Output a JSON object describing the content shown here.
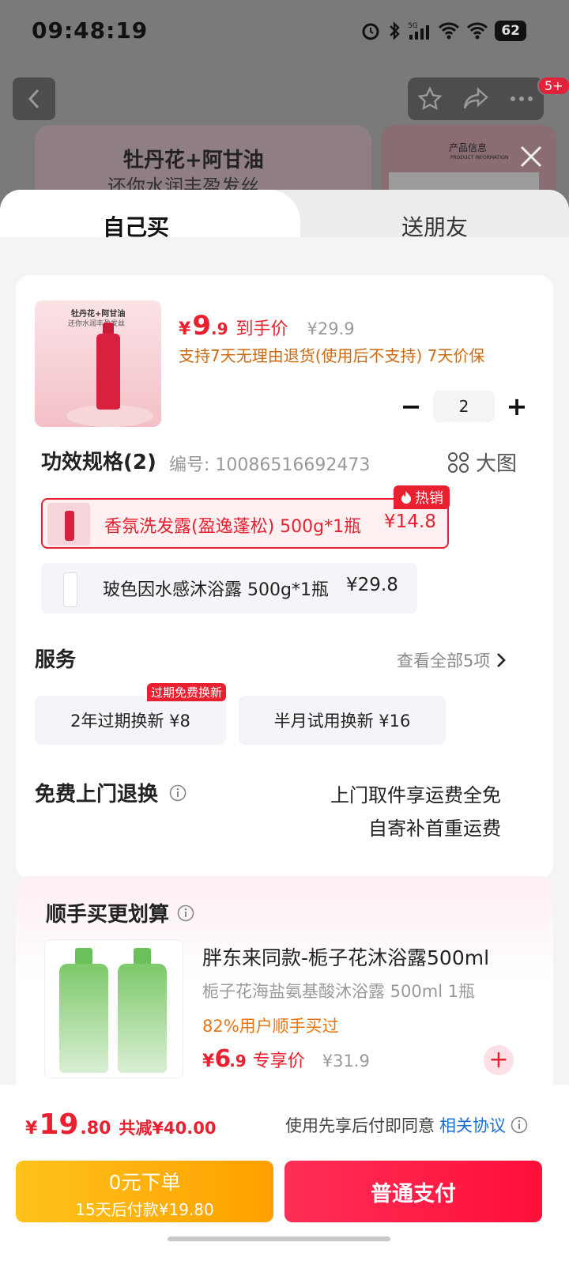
{
  "status_bar": {
    "time": "09:48:19",
    "battery": "62",
    "signal_label": "5G"
  },
  "background": {
    "badge": "5+",
    "card_title": "牡丹花+阿甘油",
    "card_subtitle": "还你水润丰盈发丝",
    "card2_title": "产品信息",
    "card2_subtitle": "PRODUCT INFORMATION"
  },
  "tabs": {
    "self": "自己买",
    "gift": "送朋友"
  },
  "product": {
    "thumb_title": "牡丹花+阿甘油",
    "thumb_subtitle": "还你水润丰盈发丝",
    "price_symbol": "¥",
    "price_int": "9",
    "price_dec": ".9",
    "price_tag": "到手价",
    "original_price": "¥29.9",
    "return_note": "支持7天无理由退货(使用后不支持)  7天价保",
    "quantity": "2",
    "minus": "−",
    "plus": "+"
  },
  "spec": {
    "title": "功效规格(2)",
    "code": "编号: 10086516692473",
    "big_image": "大图",
    "hot_badge": "热销",
    "options": [
      {
        "label": "香氛洗发露(盈逸蓬松) 500g*1瓶",
        "price": "¥14.8",
        "selected": true
      },
      {
        "label": "玻色因水感沐浴露 500g*1瓶",
        "price": "¥29.8",
        "selected": false
      }
    ]
  },
  "services": {
    "title": "服务",
    "more": "查看全部5项",
    "badge": "过期免费换新",
    "options": [
      {
        "label": "2年过期换新  ¥8"
      },
      {
        "label": "半月试用换新  ¥16"
      }
    ]
  },
  "free_return": {
    "title": "免费上门退换",
    "line1": "上门取件享运费全免",
    "line2": "自寄补首重运费"
  },
  "addon": {
    "title": "顺手买更划算",
    "name": "胖东来同款-栀子花沐浴露500ml",
    "sub": "栀子花海盐氨基酸沐浴露 500ml 1瓶",
    "rate": "82%用户顺手买过",
    "price_symbol": "¥",
    "price_int": "6",
    "price_dec": ".9",
    "price_tag": "专享价",
    "original_price": "¥31.9",
    "plus": "+"
  },
  "footer": {
    "price_symbol": "¥",
    "price_int": "19",
    "price_dec": ".80",
    "saved": "共减¥40.00",
    "agree_text": "使用先享后付即同意",
    "agree_link": "相关协议",
    "btn_later_l1": "0元下单",
    "btn_later_l2": "15天后付款¥19.80",
    "btn_pay": "普通支付"
  },
  "colors": {
    "accent": "#e8202f",
    "orange": "#cc6a12",
    "link": "#1a6fd6",
    "pay_start": "#ffc21a",
    "pay_end": "#ff0f3a"
  }
}
